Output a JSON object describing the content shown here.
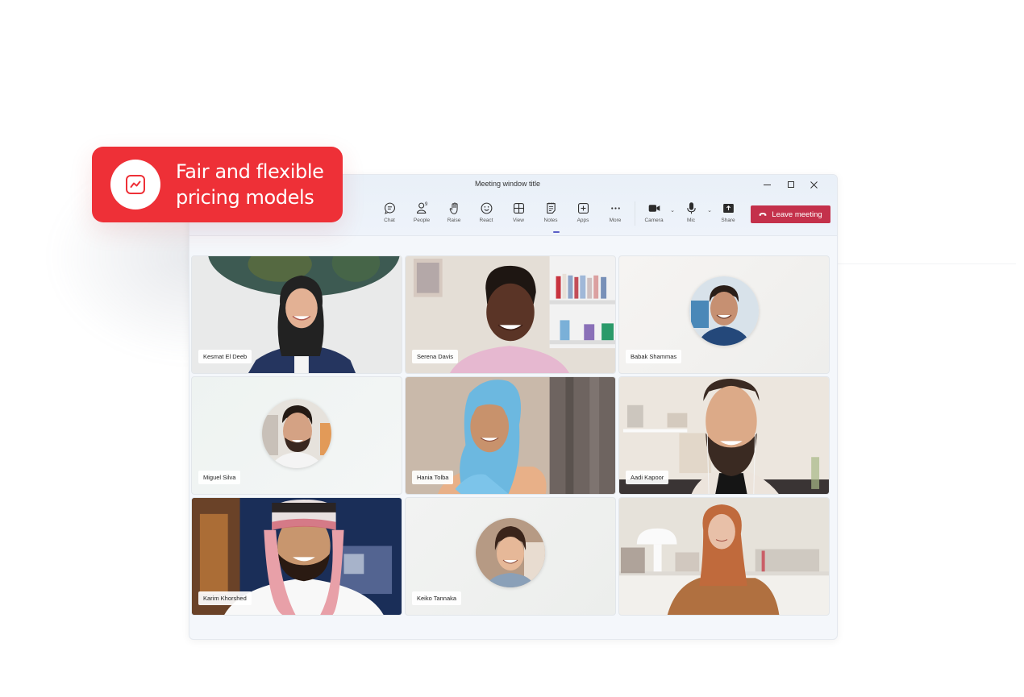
{
  "callout": {
    "icon": "trend-chart-icon",
    "line1": "Fair and flexible",
    "line2": "pricing models",
    "color": "#ee3037"
  },
  "window": {
    "title": "Meeting window title",
    "controls": {
      "minimize_icon": "minimize-icon",
      "maximize_icon": "maximize-icon",
      "close_icon": "close-icon"
    }
  },
  "toolbar": {
    "items": [
      {
        "label": "Chat",
        "icon": "chat-icon"
      },
      {
        "label": "People",
        "icon": "people-icon",
        "badge": "9"
      },
      {
        "label": "Raise",
        "icon": "raise-hand-icon"
      },
      {
        "label": "React",
        "icon": "smiley-icon"
      },
      {
        "label": "View",
        "icon": "grid-view-icon"
      },
      {
        "label": "Notes",
        "icon": "notes-icon"
      },
      {
        "label": "Apps",
        "icon": "apps-plus-icon"
      },
      {
        "label": "More",
        "icon": "more-dots-icon"
      }
    ],
    "devices": [
      {
        "label": "Camera",
        "icon": "camera-icon"
      },
      {
        "label": "Mic",
        "icon": "mic-icon"
      },
      {
        "label": "Share",
        "icon": "share-icon"
      }
    ],
    "active_item": "Notes",
    "leave_label": "Leave meeting",
    "leave_color": "#c4314b"
  },
  "participants": [
    {
      "name": "Kesmat El Deeb",
      "video": true
    },
    {
      "name": "Serena Davis",
      "video": true
    },
    {
      "name": "Babak Shammas",
      "video": false
    },
    {
      "name": "Miguel Silva",
      "video": false
    },
    {
      "name": "Hania Tolba",
      "video": true
    },
    {
      "name": "Aadi Kapoor",
      "video": true
    },
    {
      "name": "Karim Khorshed",
      "video": true
    },
    {
      "name": "Keiko Tannaka",
      "video": false
    },
    {
      "name": "",
      "video": true
    }
  ]
}
